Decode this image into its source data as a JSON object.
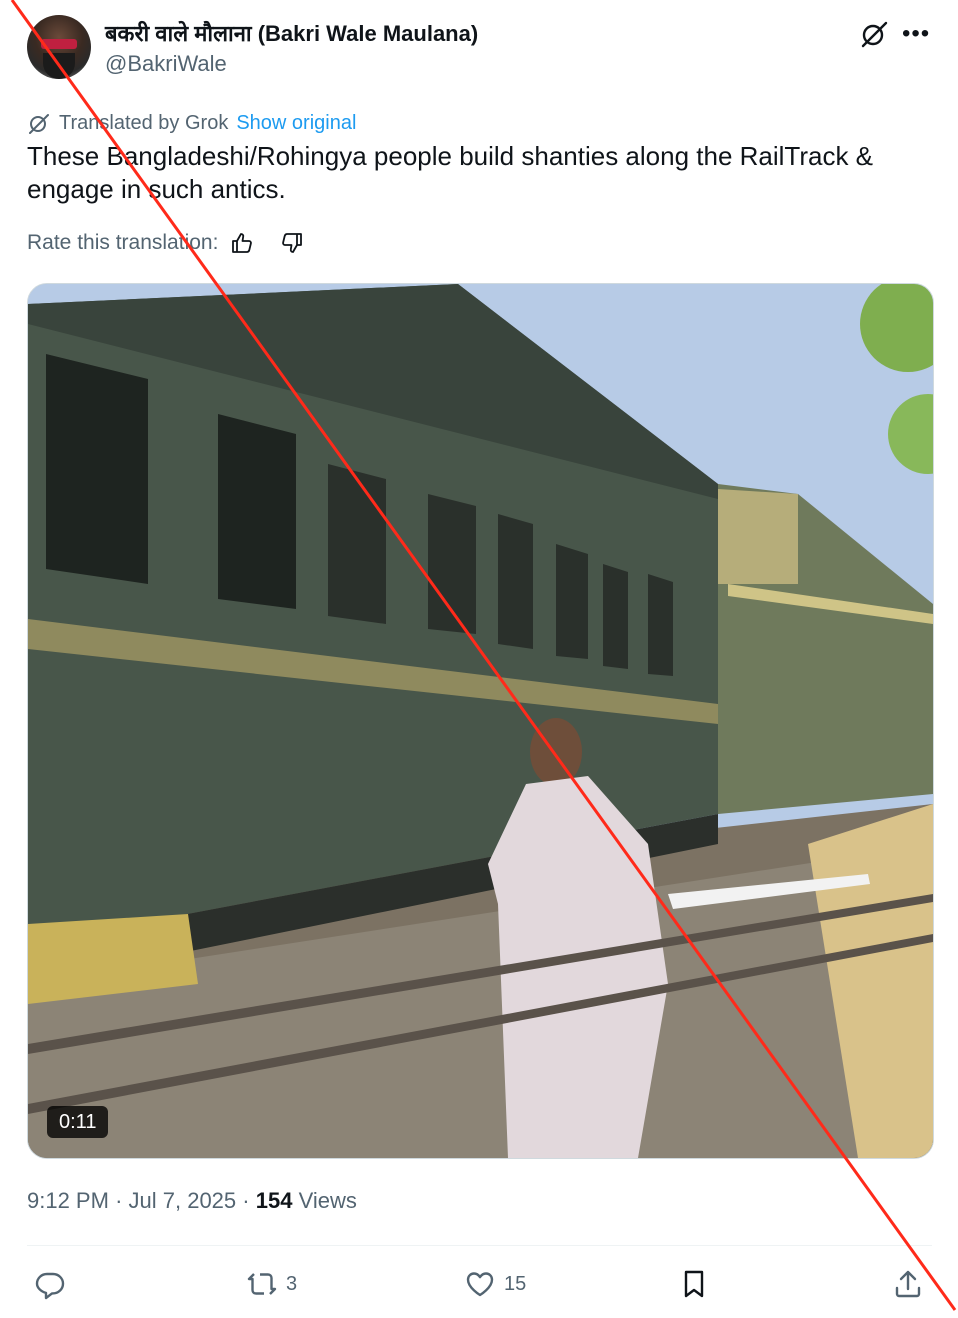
{
  "author": {
    "display_name": "बकरी वाले मौलाना (Bakri Wale Maulana)",
    "handle": "@BakriWale"
  },
  "icons": {
    "grok": "grok-icon",
    "more": "more-icon",
    "like_translation": "thumbs-up-icon",
    "dislike_translation": "thumbs-down-icon",
    "reply": "reply-icon",
    "repost": "repost-icon",
    "like": "heart-icon",
    "bookmark": "bookmark-icon",
    "share": "share-icon"
  },
  "translation": {
    "label": "Translated by Grok",
    "show_original": "Show original",
    "rate_label": "Rate this translation:"
  },
  "tweet": {
    "text": "These Bangladeshi/Rohingya people build shanties along the RailTrack & engage in such antics."
  },
  "media": {
    "duration": "0:11"
  },
  "meta": {
    "time": "9:12 PM",
    "separator": "·",
    "date": "Jul 7, 2025",
    "views_count": "154",
    "views_label": "Views"
  },
  "actions": {
    "reposts": "3",
    "likes": "15"
  },
  "colors": {
    "accent": "#1d9bf0",
    "text": "#0f1419",
    "muted": "#536471",
    "overlay_line": "#ff2a1a"
  }
}
